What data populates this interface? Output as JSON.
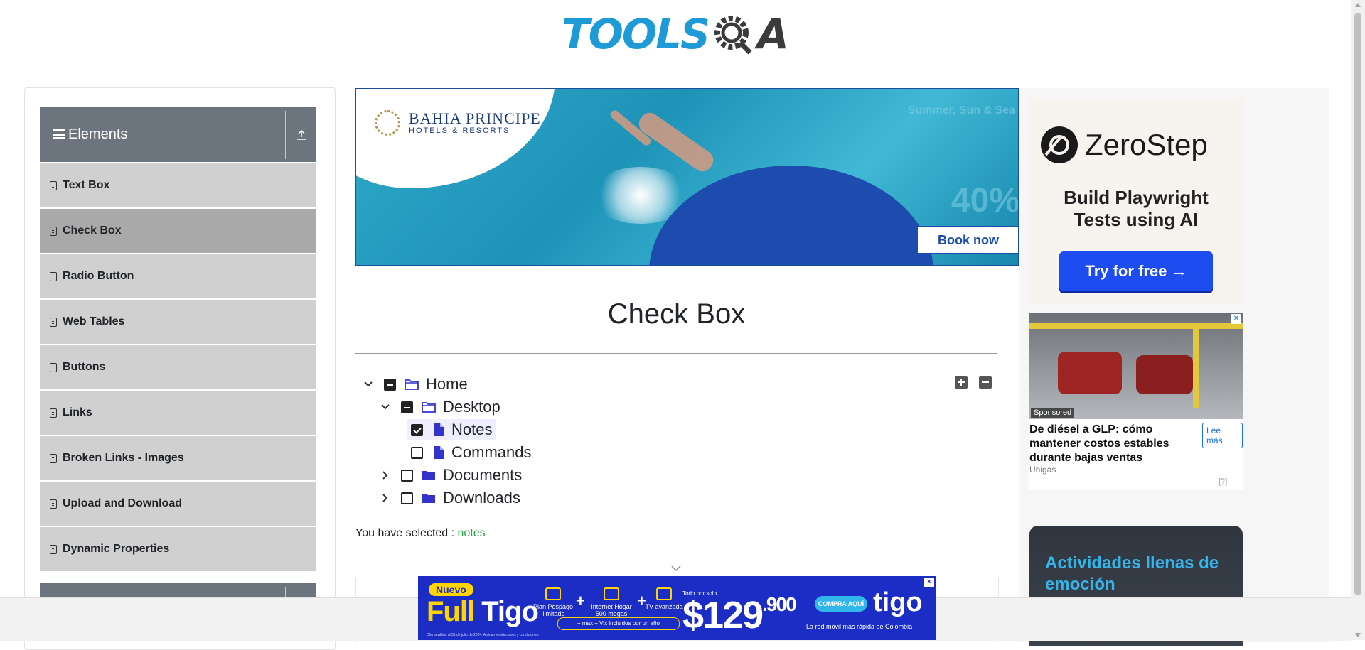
{
  "header": {
    "logo_text_left": "TOOLS",
    "logo_text_right": "A"
  },
  "sidebar": {
    "group_title": "Elements",
    "items": [
      {
        "label": "Text Box"
      },
      {
        "label": "Check Box",
        "active": true
      },
      {
        "label": "Radio Button"
      },
      {
        "label": "Web Tables"
      },
      {
        "label": "Buttons"
      },
      {
        "label": "Links"
      },
      {
        "label": "Broken Links - Images"
      },
      {
        "label": "Upload and Download"
      },
      {
        "label": "Dynamic Properties"
      }
    ]
  },
  "top_ad": {
    "brand": "BAHIA PRINCIPE",
    "brand_sub": "HOTELS & RESORTS",
    "faint_text": "Summer, Sun & Sea",
    "pct_text": "40%",
    "cta": "Book now"
  },
  "main": {
    "title": "Check Box",
    "tree": {
      "home": "Home",
      "desktop": "Desktop",
      "notes": "Notes",
      "commands": "Commands",
      "documents": "Documents",
      "downloads": "Downloads"
    },
    "result_label": "You have selected :",
    "result_value": "notes"
  },
  "right_ads": {
    "zero": {
      "brand": "ZeroStep",
      "headline_1": "Build Playwright",
      "headline_2": "Tests using AI",
      "cta": "Try for free →"
    },
    "gas": {
      "sponsored": "Sponsored",
      "title": "De diésel a GLP: cómo mantener costos estables durante bajas ventas",
      "cta": "Lee más",
      "advertiser": "Unigas",
      "info": "[?]"
    },
    "act": {
      "title_1": "Actividades llenas de",
      "title_2": "emoción"
    }
  },
  "bottom_ad": {
    "badge": "Nuevo",
    "brand_1": "Full",
    "brand_2": "Tigo",
    "feat_1": "Plan Pospago ilimitado",
    "feat_2": "Internet Hogar 500 megas",
    "feat_3": "TV avanzada",
    "pill": "+ max + Vix incluidos por un año",
    "todo": "Todo por solo",
    "price_main": "$129",
    "price_small": ".900",
    "cta": "COMPRA AQUÍ",
    "logo": "tigo",
    "tagline": "La red móvil más rápida de Colombia",
    "fine": "Oferta válida al 31 de julio de 2024. Aplican restricciones y condiciones."
  },
  "colors": {
    "sidebar_header": "#6c757d",
    "menu_item": "#d0d0d0",
    "menu_active": "#a9a9a9",
    "tree_icon": "#3333cc",
    "result_value": "#28a745"
  }
}
